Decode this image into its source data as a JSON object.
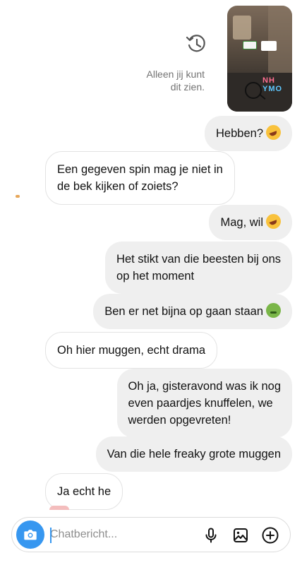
{
  "story_reply": {
    "private_note_line1": "Alleen jij kunt",
    "private_note_line2": "dit zien.",
    "thumbnail_text_1": "NH",
    "thumbnail_text_2": "YMO"
  },
  "messages": [
    {
      "direction": "outgoing",
      "text": "Hebben?",
      "emoji": "rolling-on-floor-laughing"
    },
    {
      "direction": "incoming",
      "line1": "Een gegeven spin mag je niet in",
      "line2": "de bek kijken of zoiets?"
    },
    {
      "direction": "outgoing",
      "text": "Mag, wil",
      "emoji": "rolling-on-floor-laughing"
    },
    {
      "direction": "outgoing",
      "line1": "Het stikt van die beesten bij ons",
      "line2": "op het moment"
    },
    {
      "direction": "outgoing",
      "text": "Ben er net bijna op gaan staan",
      "emoji": "nauseated-face"
    },
    {
      "direction": "incoming",
      "text": "Oh hier muggen, echt drama"
    },
    {
      "direction": "outgoing",
      "line1": "Oh ja, gisteravond was ik nog",
      "line2": "even paardjes knuffelen, we",
      "line3": "werden opgevreten!"
    },
    {
      "direction": "outgoing",
      "text": "Van die hele freaky grote muggen"
    },
    {
      "direction": "incoming",
      "text": "Ja echt he"
    }
  ],
  "composer": {
    "placeholder": "Chatbericht...",
    "value": ""
  },
  "icons": {
    "camera": "camera-icon",
    "mic": "microphone-icon",
    "gallery": "gallery-icon",
    "add": "add-circle-icon",
    "history": "history-icon"
  },
  "colors": {
    "accent": "#3797f0",
    "outgoing_bubble": "#efefef",
    "incoming_border": "#e3e3e3",
    "muted_text": "#737373"
  }
}
